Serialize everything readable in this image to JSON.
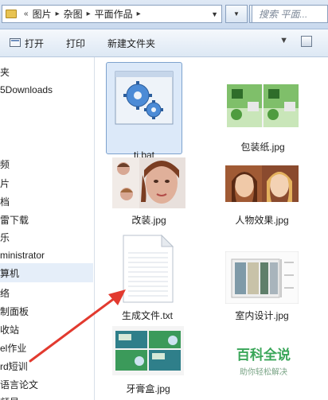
{
  "address": {
    "crumbs": [
      "图片",
      "杂图",
      "平面作品"
    ],
    "search_placeholder": "搜索 平面..."
  },
  "toolbar": {
    "open_label": "打开",
    "print_label": "打印",
    "new_folder_label": "新建文件夹"
  },
  "sidebar": {
    "items": [
      {
        "label": "夹"
      },
      {
        "label": "5Downloads"
      },
      {
        "label": "频"
      },
      {
        "label": "片"
      },
      {
        "label": "档"
      },
      {
        "label": "雷下载"
      },
      {
        "label": "乐"
      },
      {
        "label": "ministrator"
      },
      {
        "label": "算机"
      },
      {
        "label": "络"
      },
      {
        "label": "制面板"
      },
      {
        "label": "收站"
      },
      {
        "label": "el作业"
      },
      {
        "label": "rd短训"
      },
      {
        "label": "语言论文"
      },
      {
        "label": "频显"
      }
    ]
  },
  "files": [
    {
      "name": "ti.bat",
      "selected": true
    },
    {
      "name": "包装纸.jpg",
      "selected": false
    },
    {
      "name": "改装.jpg",
      "selected": false
    },
    {
      "name": "人物效果.jpg",
      "selected": false
    },
    {
      "name": "生成文件.txt",
      "selected": false
    },
    {
      "name": "室内设计.jpg",
      "selected": false
    },
    {
      "name": "牙膏盒.jpg",
      "selected": false
    }
  ],
  "watermark": {
    "title": "百科全说",
    "subtitle": "助你轻松解决"
  },
  "colors": {
    "accent": "#3aa659",
    "arrow": "#e23a2f",
    "selection": "#dce9f9"
  }
}
